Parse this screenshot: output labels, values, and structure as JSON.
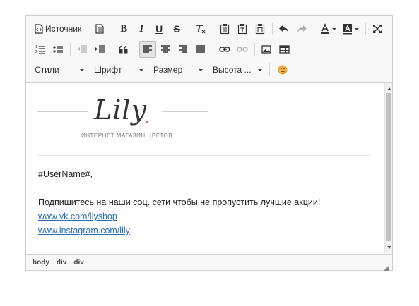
{
  "toolbar": {
    "source_label": "Источник",
    "combos": [
      {
        "label": "Стили"
      },
      {
        "label": "Шрифт"
      },
      {
        "label": "Размер"
      },
      {
        "label": "Высота ..."
      }
    ],
    "format": {
      "bold": "B",
      "italic": "I",
      "underline": "U",
      "strike": "S",
      "remove_format": "T"
    }
  },
  "content": {
    "logo": {
      "script": "Lily",
      "subtitle": "ИНТЕРНЕТ МАГАЗИН ЦВЕТОВ",
      "dot_color": "#e0507a"
    },
    "greeting": "#UserName#,",
    "message": "Подпишитесь на наши соц. сети чтобы не пропустить лучшие акции!",
    "links": [
      {
        "text": "www.vk.com/liyshop"
      },
      {
        "text": "www.instagram.com/lily"
      }
    ]
  },
  "statusbar": {
    "path": [
      "body",
      "div",
      "div"
    ]
  },
  "colors": {
    "link": "#2a6db4",
    "toolbar_bg": "#f8f8f8",
    "border": "#d1d1d1"
  }
}
